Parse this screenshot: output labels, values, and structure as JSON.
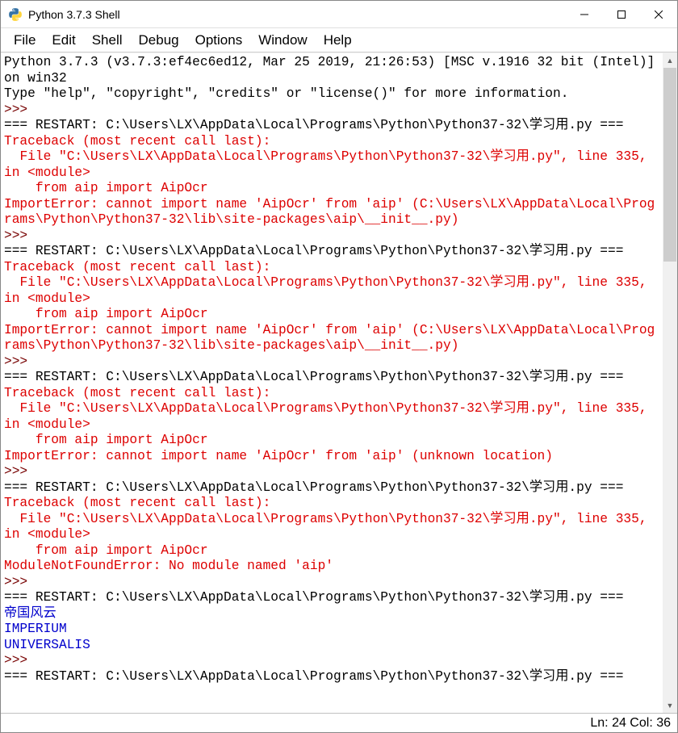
{
  "window": {
    "title": "Python 3.7.3 Shell"
  },
  "menu": {
    "items": [
      "File",
      "Edit",
      "Shell",
      "Debug",
      "Options",
      "Window",
      "Help"
    ]
  },
  "shell": {
    "banner1": "Python 3.7.3 (v3.7.3:ef4ec6ed12, Mar 25 2019, 21:26:53) [MSC v.1916 32 bit (Intel)] on win32",
    "banner2": "Type \"help\", \"copyright\", \"credits\" or \"license()\" for more information.",
    "prompt": ">>>",
    "restart": "=== RESTART: C:\\Users\\LX\\AppData\\Local\\Programs\\Python\\Python37-32\\学习用.py ===",
    "tb_header": "Traceback (most recent call last):",
    "tb_file": "  File \"C:\\Users\\LX\\AppData\\Local\\Programs\\Python\\Python37-32\\学习用.py\", line 335, in <module>",
    "tb_src": "    from aip import AipOcr",
    "err_long": "ImportError: cannot import name 'AipOcr' from 'aip' (C:\\Users\\LX\\AppData\\Local\\Programs\\Python\\Python37-32\\lib\\site-packages\\aip\\__init__.py)",
    "err_unknown": "ImportError: cannot import name 'AipOcr' from 'aip' (unknown location)",
    "err_mod": "ModuleNotFoundError: No module named 'aip'",
    "out1": "帝国风云",
    "out2": "IMPERIUM",
    "out3": "UNIVERSALIS"
  },
  "status": {
    "text": "Ln: 24  Col: 36"
  }
}
